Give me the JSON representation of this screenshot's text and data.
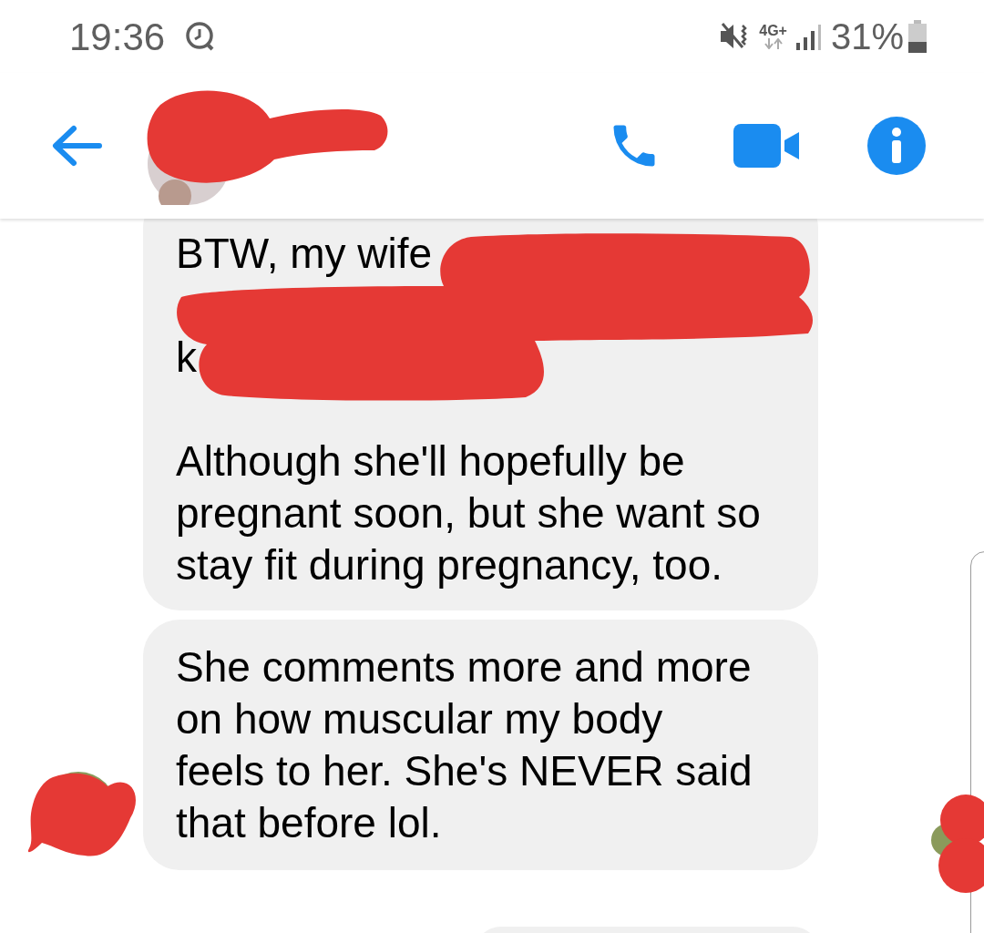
{
  "status_bar": {
    "time": "19:36",
    "network": "4G+",
    "battery": "31%"
  },
  "messages": [
    {
      "paragraphs": [
        {
          "lines": [
            "BTW, my wife",
            "k"
          ],
          "redacted": true
        },
        {
          "lines": [
            "Although she'll hopefully be",
            "pregnant soon, but she want so",
            "stay fit during pregnancy, too."
          ],
          "redacted": false
        }
      ],
      "avatar": false
    },
    {
      "paragraphs": [
        {
          "lines": [
            "She comments more and more",
            "on how muscular my body",
            "feels to her. She's NEVER said",
            "that before lol."
          ],
          "redacted": false
        }
      ],
      "avatar": true
    }
  ]
}
